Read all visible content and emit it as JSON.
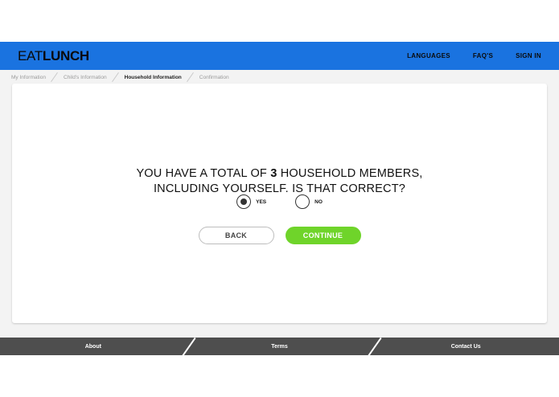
{
  "header": {
    "logo_thin": "EAT",
    "logo_bold": "LUNCH",
    "nav": [
      "LANGUAGES",
      "FAQ'S",
      "SIGN IN"
    ]
  },
  "breadcrumb": [
    "My Information",
    "Child's Information",
    "Household Information",
    "Confirmation"
  ],
  "question": {
    "line1_prefix": "YOU HAVE A TOTAL OF",
    "count": "3",
    "line1_suffix": "HOUSEHOLD MEMBERS,",
    "line2": "INCLUDING YOURSELF. IS THAT CORRECT?"
  },
  "options": {
    "yes": "YES",
    "no": "NO",
    "selected": "YES"
  },
  "buttons": {
    "back": "BACK",
    "continue": "CONTINUE"
  },
  "footer": [
    "About",
    "Terms",
    "Contact Us"
  ],
  "colors": {
    "header_bg": "#1a73e0",
    "continue_bg": "#6fd42a",
    "footer_bg": "#4e4e4e",
    "page_bg": "#f3f3f3"
  }
}
